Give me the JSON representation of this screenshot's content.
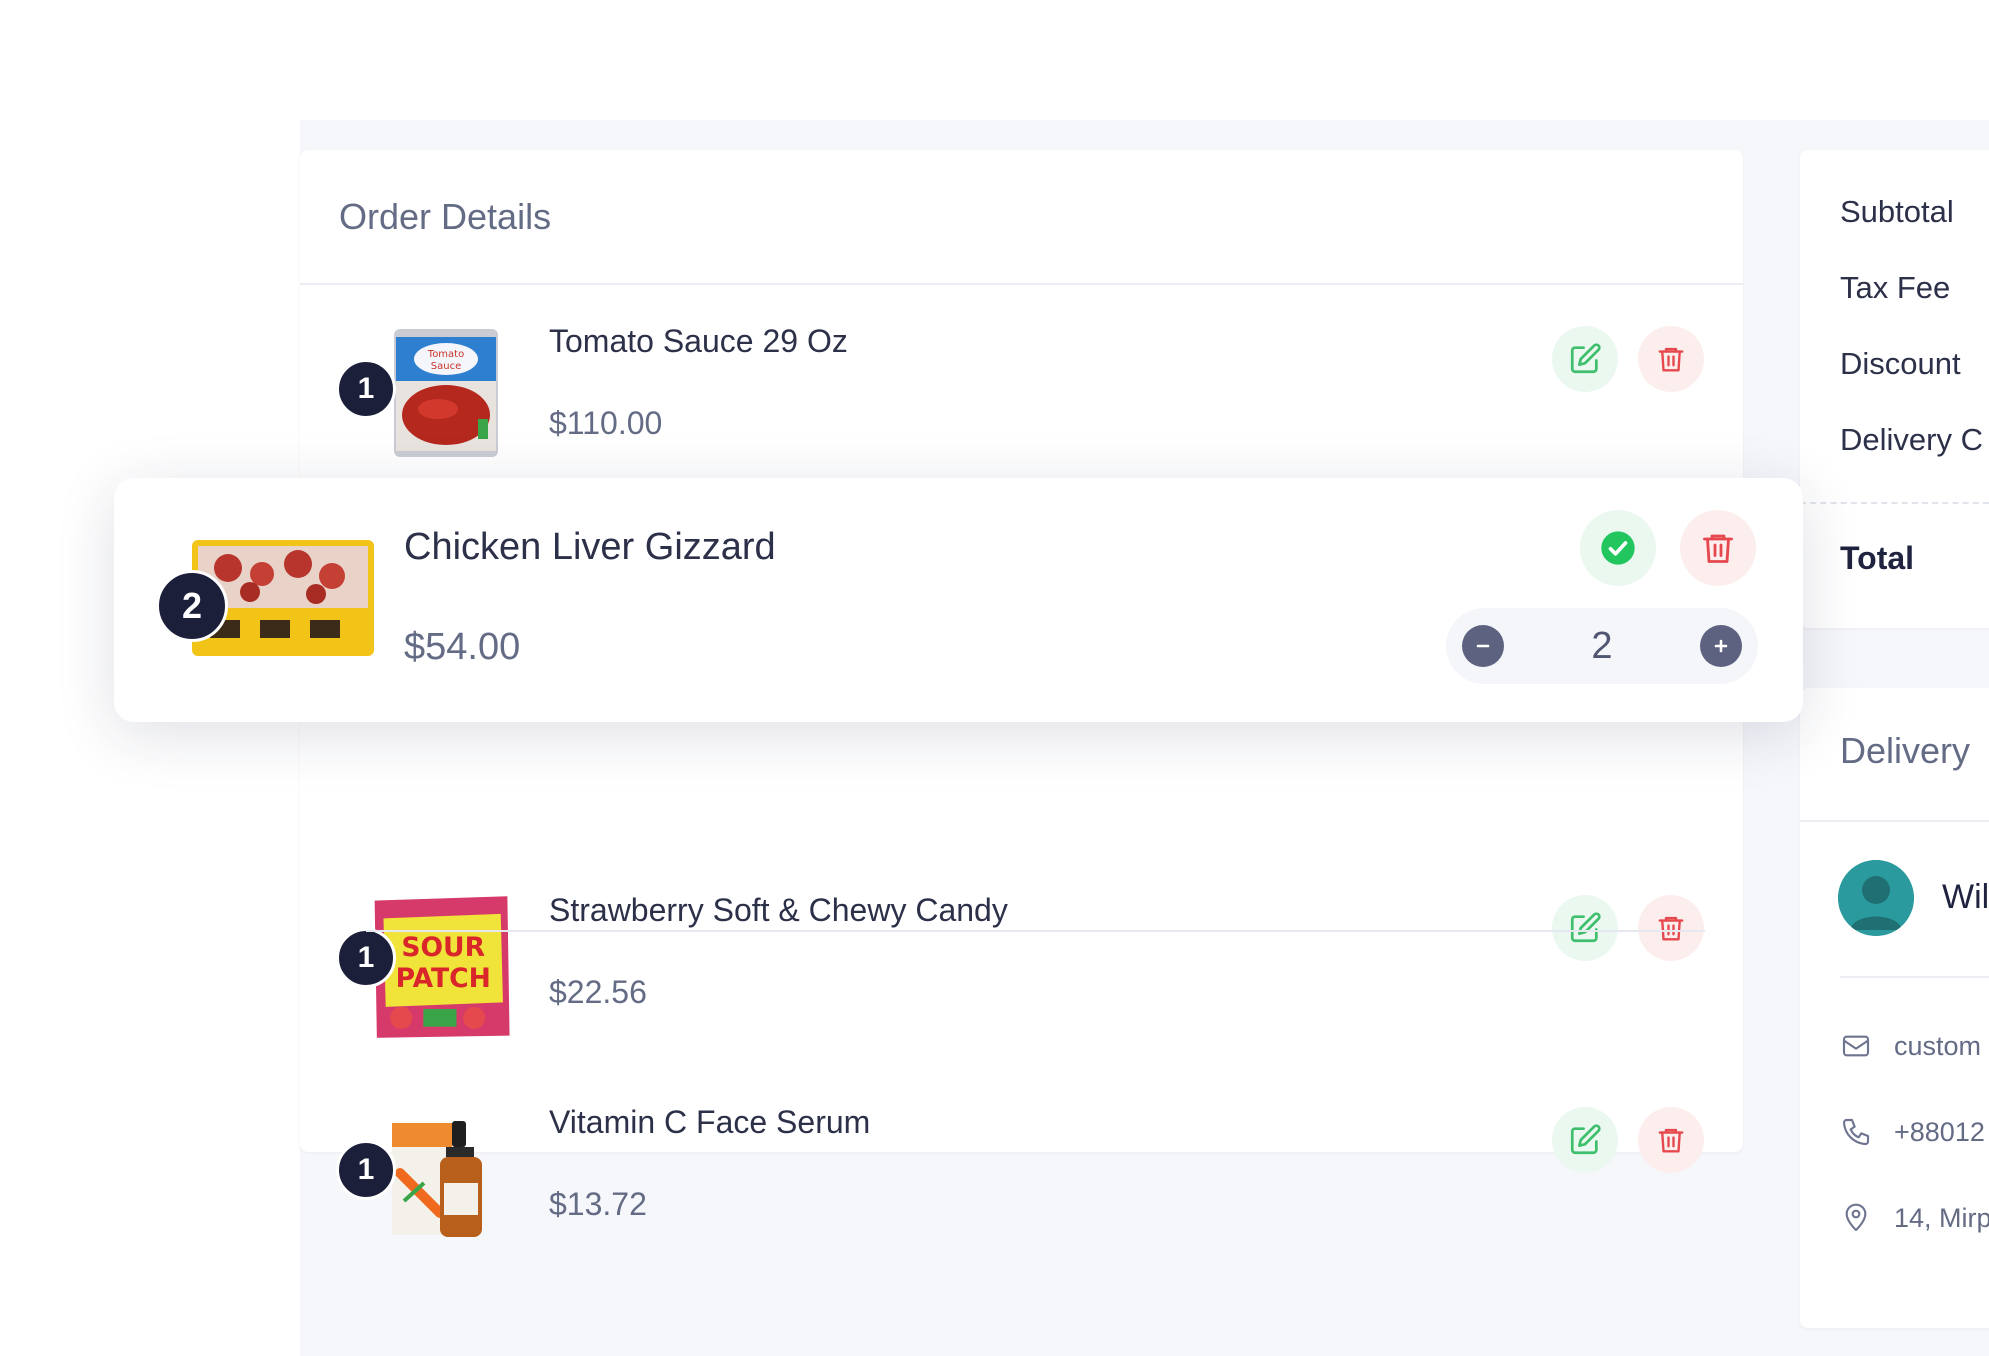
{
  "order_details": {
    "title": "Order Details",
    "items": [
      {
        "name": "Tomato Sauce 29 Oz",
        "price": "$110.00",
        "quantity": "1",
        "image": "tomato-sauce-can"
      },
      {
        "name": "Chicken Liver Gizzard",
        "price": "$54.00",
        "quantity": "2",
        "image": "chicken-liver-pack"
      },
      {
        "name": "Strawberry Soft & Chewy Candy",
        "price": "$22.56",
        "quantity": "1",
        "image": "sour-patch-bag"
      },
      {
        "name": "Vitamin C Face Serum",
        "price": "$13.72",
        "quantity": "1",
        "image": "serum-bottle"
      }
    ],
    "editing": {
      "quantity_value": "2"
    }
  },
  "summary": {
    "subtotal_label": "Subtotal",
    "tax_label": "Tax Fee",
    "discount_label": "Discount",
    "delivery_label": "Delivery C",
    "total_label": "Total"
  },
  "delivery": {
    "title": "Delivery",
    "customer_name": "Wil",
    "email": "custom",
    "phone": "+88012",
    "address": "14, Mirp"
  },
  "colors": {
    "accent_green": "#22c55e",
    "danger_red": "#e5484d",
    "badge_dark": "#1c1f3a",
    "muted_text": "#646b85"
  },
  "icons": [
    "edit-icon",
    "trash-icon",
    "check-circle-icon",
    "minus-icon",
    "plus-icon",
    "mail-icon",
    "phone-icon",
    "location-icon",
    "user-avatar-icon"
  ]
}
